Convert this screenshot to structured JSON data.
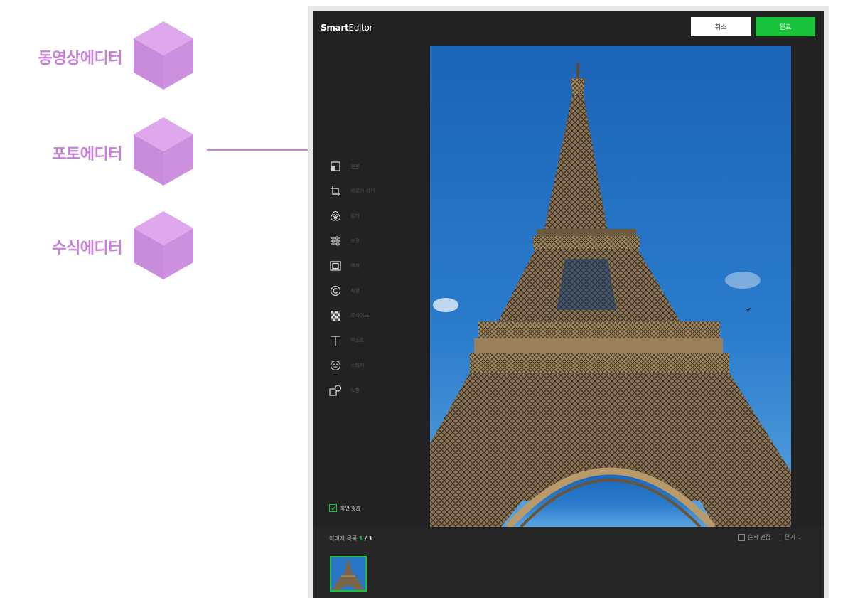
{
  "annotations": [
    {
      "label": "동영상에디터"
    },
    {
      "label": "포토에디터"
    },
    {
      "label": "수식에디터"
    }
  ],
  "app": {
    "logo_bold": "Smart",
    "logo_light": "Editor",
    "cancel_label": "취소",
    "done_label": "완료",
    "fit_label": "화면 맞춤",
    "image_list_label": "이미지 목록",
    "image_count": "1",
    "image_total": "/ 1",
    "order_edit_label": "순서 편집",
    "close_label": "닫기 ⌄"
  },
  "tools": [
    {
      "label": "원본",
      "icon": "original-icon"
    },
    {
      "label": "자르기·회전",
      "icon": "crop-icon"
    },
    {
      "label": "필터",
      "icon": "filter-icon"
    },
    {
      "label": "보정",
      "icon": "adjust-icon"
    },
    {
      "label": "액자",
      "icon": "frame-icon"
    },
    {
      "label": "서명",
      "icon": "signature-icon"
    },
    {
      "label": "모자이크",
      "icon": "mosaic-icon"
    },
    {
      "label": "텍스트",
      "icon": "text-icon"
    },
    {
      "label": "스티커",
      "icon": "sticker-icon"
    },
    {
      "label": "도형",
      "icon": "shape-icon"
    }
  ],
  "colors": {
    "accent": "#18c23a",
    "annotation": "#c77fd9",
    "sky": "#1f6fc2"
  }
}
